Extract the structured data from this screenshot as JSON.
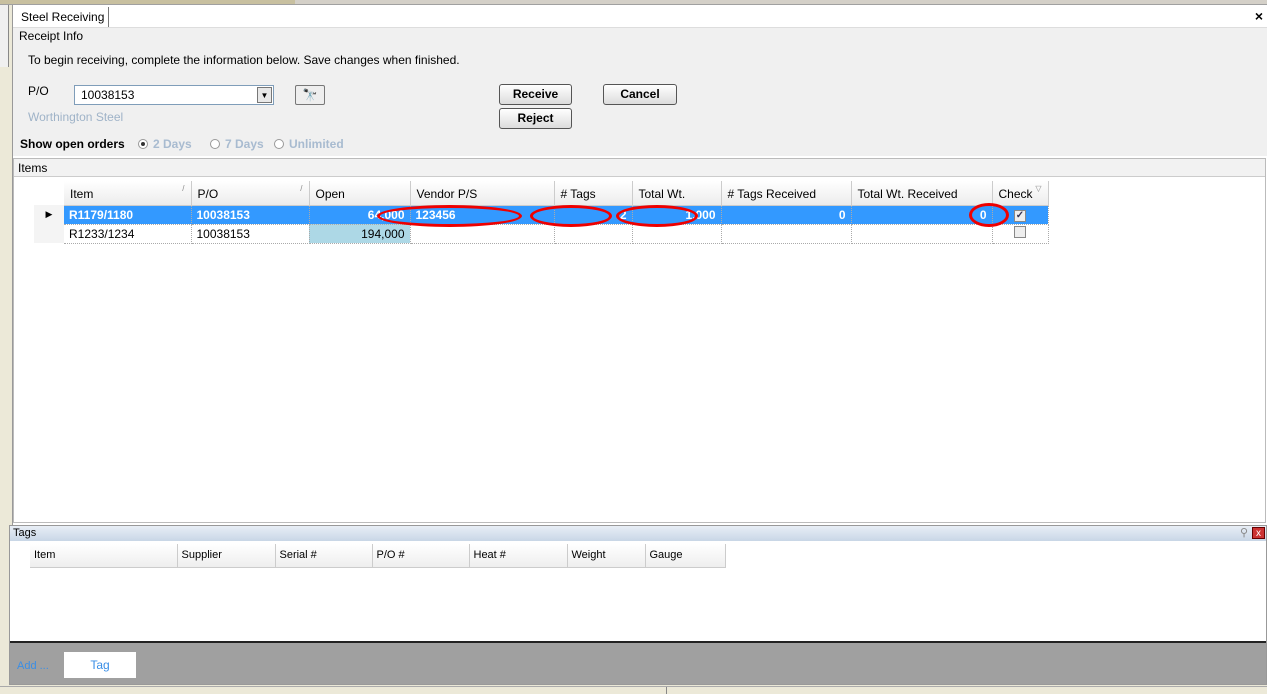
{
  "window": {
    "tab_label": "Steel Receiving",
    "close_label": "×"
  },
  "receipt": {
    "legend": "Receipt Info",
    "instructions": "To begin receiving, complete the information below.  Save changes when finished.",
    "po_label": "P/O",
    "po_value": "10038153",
    "vendor": "Worthington Steel",
    "receive_label": "Receive",
    "reject_label": "Reject",
    "cancel_label": "Cancel",
    "show_open_label": "Show open orders",
    "options": [
      {
        "label": "2 Days",
        "selected": true
      },
      {
        "label": "7 Days",
        "selected": false
      },
      {
        "label": "Unlimited",
        "selected": false
      }
    ]
  },
  "items": {
    "title": "Items",
    "columns": [
      "Item",
      "P/O",
      "Open",
      "Vendor P/S",
      "# Tags",
      "Total Wt.",
      "# Tags Received",
      "Total Wt. Received",
      "Check"
    ],
    "rows": [
      {
        "item": "R1179/1180",
        "po": "10038153",
        "open": "64,000",
        "vendor_ps": "123456",
        "tags": "2",
        "total_wt": "1,000",
        "tags_received": "0",
        "wt_received": "0",
        "check": true,
        "selected": true
      },
      {
        "item": "R1233/1234",
        "po": "10038153",
        "open": "194,000",
        "vendor_ps": "",
        "tags": "",
        "total_wt": "",
        "tags_received": "",
        "wt_received": "",
        "check": false,
        "selected": false
      }
    ]
  },
  "tags": {
    "title": "Tags",
    "columns": [
      "Item",
      "Supplier",
      "Serial #",
      "P/O #",
      "Heat #",
      "Weight",
      "Gauge"
    ],
    "add_label": "Add ...",
    "tag_button": "Tag"
  },
  "colors": {
    "selection": "#3399ff",
    "annotation": "#e00000"
  }
}
